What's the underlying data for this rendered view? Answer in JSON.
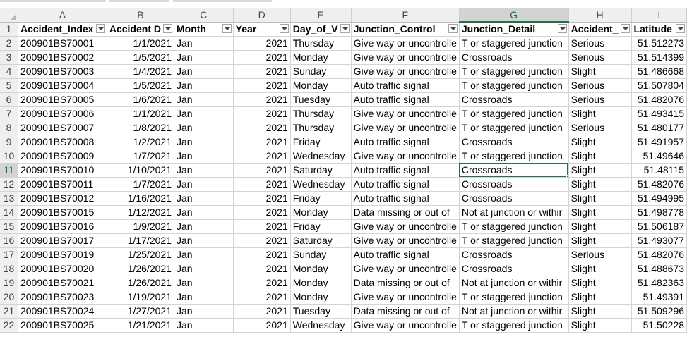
{
  "columns": [
    "A",
    "B",
    "C",
    "D",
    "E",
    "F",
    "G",
    "H",
    "I"
  ],
  "selected_column": "G",
  "headers": [
    "Accident_Index",
    "Accident D",
    "Month",
    "Year",
    "Day_of_V",
    "Junction_Control",
    "Junction_Detail",
    "Accident_",
    "Latitude"
  ],
  "row_numbers": [
    "1",
    "2",
    "3",
    "4",
    "5",
    "6",
    "7",
    "8",
    "9",
    "10",
    "11",
    "12",
    "13",
    "14",
    "15",
    "16",
    "17",
    "18",
    "19",
    "20",
    "21",
    "22"
  ],
  "selected_row": "11",
  "active_cell": "G11",
  "rows": [
    [
      "200901BS70001",
      "1/1/2021",
      "Jan",
      "2021",
      "Thursday",
      "Give way or uncontrolle",
      "T or staggered junction",
      "Serious",
      "51.512273"
    ],
    [
      "200901BS70002",
      "1/5/2021",
      "Jan",
      "2021",
      "Monday",
      "Give way or uncontrolle",
      "Crossroads",
      "Serious",
      "51.514399"
    ],
    [
      "200901BS70003",
      "1/4/2021",
      "Jan",
      "2021",
      "Sunday",
      "Give way or uncontrolle",
      "T or staggered junction",
      "Slight",
      "51.486668"
    ],
    [
      "200901BS70004",
      "1/5/2021",
      "Jan",
      "2021",
      "Monday",
      "Auto traffic signal",
      "T or staggered junction",
      "Serious",
      "51.507804"
    ],
    [
      "200901BS70005",
      "1/6/2021",
      "Jan",
      "2021",
      "Tuesday",
      "Auto traffic signal",
      "Crossroads",
      "Serious",
      "51.482076"
    ],
    [
      "200901BS70006",
      "1/1/2021",
      "Jan",
      "2021",
      "Thursday",
      "Give way or uncontrolle",
      "T or staggered junction",
      "Slight",
      "51.493415"
    ],
    [
      "200901BS70007",
      "1/8/2021",
      "Jan",
      "2021",
      "Thursday",
      "Give way or uncontrolle",
      "T or staggered junction",
      "Serious",
      "51.480177"
    ],
    [
      "200901BS70008",
      "1/2/2021",
      "Jan",
      "2021",
      "Friday",
      "Auto traffic signal",
      "Crossroads",
      "Slight",
      "51.491957"
    ],
    [
      "200901BS70009",
      "1/7/2021",
      "Jan",
      "2021",
      "Wednesday",
      "Give way or uncontrolle",
      "T or staggered junction",
      "Slight",
      "51.49646"
    ],
    [
      "200901BS70010",
      "1/10/2021",
      "Jan",
      "2021",
      "Saturday",
      "Auto traffic signal",
      "Crossroads",
      "Slight",
      "51.48115"
    ],
    [
      "200901BS70011",
      "1/7/2021",
      "Jan",
      "2021",
      "Wednesday",
      "Auto traffic signal",
      "Crossroads",
      "Slight",
      "51.482076"
    ],
    [
      "200901BS70012",
      "1/16/2021",
      "Jan",
      "2021",
      "Friday",
      "Auto traffic signal",
      "Crossroads",
      "Slight",
      "51.494995"
    ],
    [
      "200901BS70015",
      "1/12/2021",
      "Jan",
      "2021",
      "Monday",
      "Data missing or out of",
      "Not at junction or withir",
      "Slight",
      "51.498778"
    ],
    [
      "200901BS70016",
      "1/9/2021",
      "Jan",
      "2021",
      "Friday",
      "Give way or uncontrolle",
      "T or staggered junction",
      "Slight",
      "51.506187"
    ],
    [
      "200901BS70017",
      "1/17/2021",
      "Jan",
      "2021",
      "Saturday",
      "Give way or uncontrolle",
      "T or staggered junction",
      "Slight",
      "51.493077"
    ],
    [
      "200901BS70019",
      "1/25/2021",
      "Jan",
      "2021",
      "Sunday",
      "Auto traffic signal",
      "Crossroads",
      "Serious",
      "51.482076"
    ],
    [
      "200901BS70020",
      "1/26/2021",
      "Jan",
      "2021",
      "Monday",
      "Give way or uncontrolle",
      "Crossroads",
      "Slight",
      "51.488673"
    ],
    [
      "200901BS70021",
      "1/26/2021",
      "Jan",
      "2021",
      "Monday",
      "Data missing or out of",
      "Not at junction or withir",
      "Slight",
      "51.482363"
    ],
    [
      "200901BS70023",
      "1/19/2021",
      "Jan",
      "2021",
      "Monday",
      "Give way or uncontrolle",
      "T or staggered junction",
      "Slight",
      "51.49391"
    ],
    [
      "200901BS70024",
      "1/27/2021",
      "Jan",
      "2021",
      "Tuesday",
      "Data missing or out of",
      "Not at junction or withir",
      "Slight",
      "51.509296"
    ],
    [
      "200901BS70025",
      "1/21/2021",
      "Jan",
      "2021",
      "Wednesday",
      "Give way or uncontrolle",
      "T or staggered junction",
      "Slight",
      "51.50228"
    ]
  ]
}
